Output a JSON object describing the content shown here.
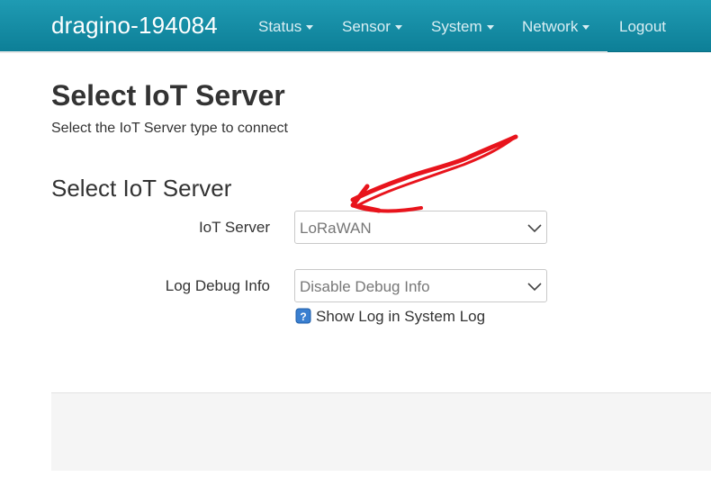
{
  "header": {
    "brand": "dragino-194084",
    "menu": [
      {
        "label": "Status",
        "has_caret": true
      },
      {
        "label": "Sensor",
        "has_caret": true
      },
      {
        "label": "System",
        "has_caret": true
      },
      {
        "label": "Network",
        "has_caret": true
      },
      {
        "label": "Logout",
        "has_caret": false
      }
    ]
  },
  "page": {
    "title": "Select IoT Server",
    "description": "Select the IoT Server type to connect"
  },
  "section": {
    "title": "Select IoT Server",
    "fields": [
      {
        "label": "IoT Server",
        "selected": "LoRaWAN"
      },
      {
        "label": "Log Debug Info",
        "selected": "Disable Debug Info",
        "help": "Show Log in System Log"
      }
    ]
  },
  "colors": {
    "navbar": "#1592aa",
    "annotation": "#e8141c"
  },
  "icons": {
    "dropdown": "chevron-down-icon",
    "help": "help-icon",
    "annotation": "red-arrow"
  }
}
